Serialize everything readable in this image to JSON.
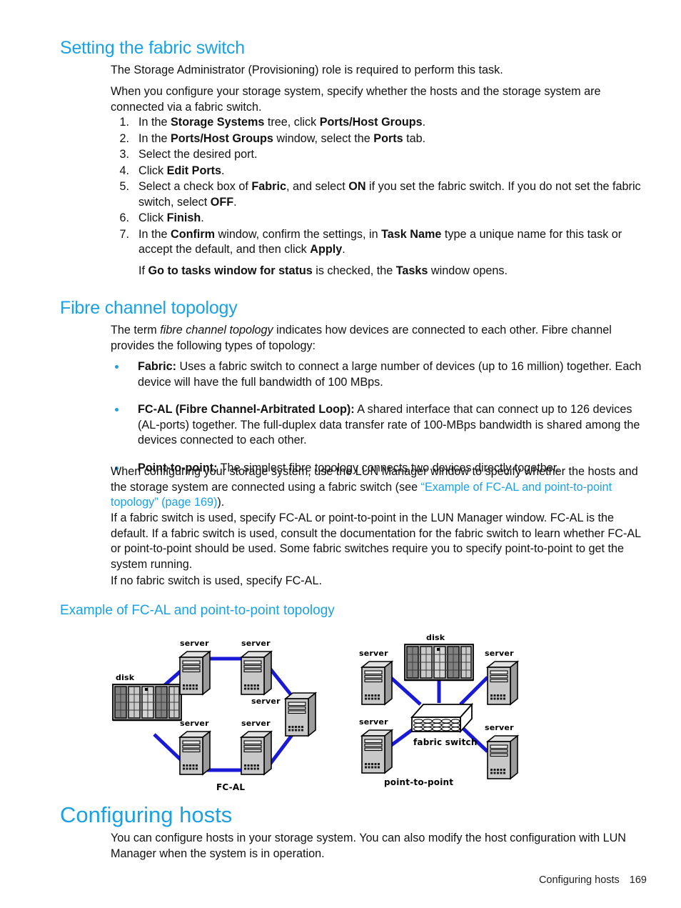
{
  "doc": {
    "section1": {
      "heading": "Setting the fabric switch",
      "p1": "The Storage Administrator (Provisioning) role is required to perform this task.",
      "p2": "When you configure your storage system, specify whether the hosts and the storage system are connected via a fabric switch.",
      "steps": [
        {
          "num": "1.",
          "text": "In the Storage Systems tree, click Ports/Host Groups."
        },
        {
          "num": "2.",
          "text": "In the Ports/Host Groups window, select the Ports tab."
        },
        {
          "num": "3.",
          "text": "Select the desired port."
        },
        {
          "num": "4.",
          "text": "Click Edit Ports."
        },
        {
          "num": "5.",
          "text": "Select a check box of Fabric, and select ON if you set the fabric switch. If you do not set the fabric switch, select OFF."
        },
        {
          "num": "6.",
          "text": "Click Finish."
        },
        {
          "num": "7.",
          "text": "In the Confirm window, confirm the settings, in Task Name type a unique name for this task or accept the default, and then click Apply."
        }
      ],
      "substep": "If Go to tasks window for status is checked, the Tasks window opens."
    },
    "section2": {
      "heading": "Fibre channel topology",
      "intro": "The term fibre channel topology indicates how devices are connected to each other. Fibre channel provides the following types of topology:",
      "bullets": [
        {
          "term": "Fabric:",
          "text": "Uses a fabric switch to connect a large number of devices (up to 16 million) together. Each device will have the full bandwidth of 100 MBps."
        },
        {
          "term": "FC-AL (Fibre Channel-Arbitrated Loop):",
          "text": "A shared interface that can connect up to 126 devices (AL-ports) together. The full-duplex data transfer rate of 100-MBps bandwidth is shared among the devices connected to each other."
        },
        {
          "term": "Point-to-point:",
          "text": "The simplest fibre topology connects two devices directly together."
        }
      ],
      "p3_before": "When configuring your storage system, use the LUN Manager window to specify whether the hosts and the storage system are connected using a fabric switch (see ",
      "p3_link": "“Example of FC-AL and point-to-point topology” (page 169)",
      "p3_after": ").",
      "p4": "If a fabric switch is used, specify FC-AL or point-to-point in the LUN Manager window. FC-AL is the default. If a fabric switch is used, consult the documentation for the fabric switch to learn whether FC-AL or point-to-point should be used. Some fabric switches require you to specify point-to-point to get the system running.",
      "p5": "If no fabric switch is used, specify FC-AL."
    },
    "figure": {
      "heading": "Example of FC-AL and point-to-point topology",
      "left": {
        "caption": "FC-AL",
        "disk_label": "disk",
        "server_label": "server",
        "servers": 5,
        "disks": 1
      },
      "right": {
        "caption": "point-to-point",
        "disk_label": "disk",
        "server_label": "server",
        "switch_label": "fabric switch",
        "servers": 4,
        "disks": 1
      },
      "colors": {
        "link": "#1a1ad6",
        "server_front": "#c6c6c6",
        "server_side": "#9a9a9a",
        "server_top": "#e4e4e4",
        "disk_dark": "#7a7a7a",
        "disk_light": "#d3d3d3"
      }
    },
    "section3": {
      "heading": "Configuring hosts",
      "p1": "You can configure hosts in your storage system. You can also modify the host configuration with LUN Manager when the system is in operation."
    },
    "footer": {
      "chapter": "Configuring hosts",
      "page": "169"
    },
    "theme": {
      "heading_color": "#1ba1e2",
      "link_color": "#1ba1e2",
      "bullet_color": "#1ba1e2",
      "text_color": "#111111"
    }
  }
}
